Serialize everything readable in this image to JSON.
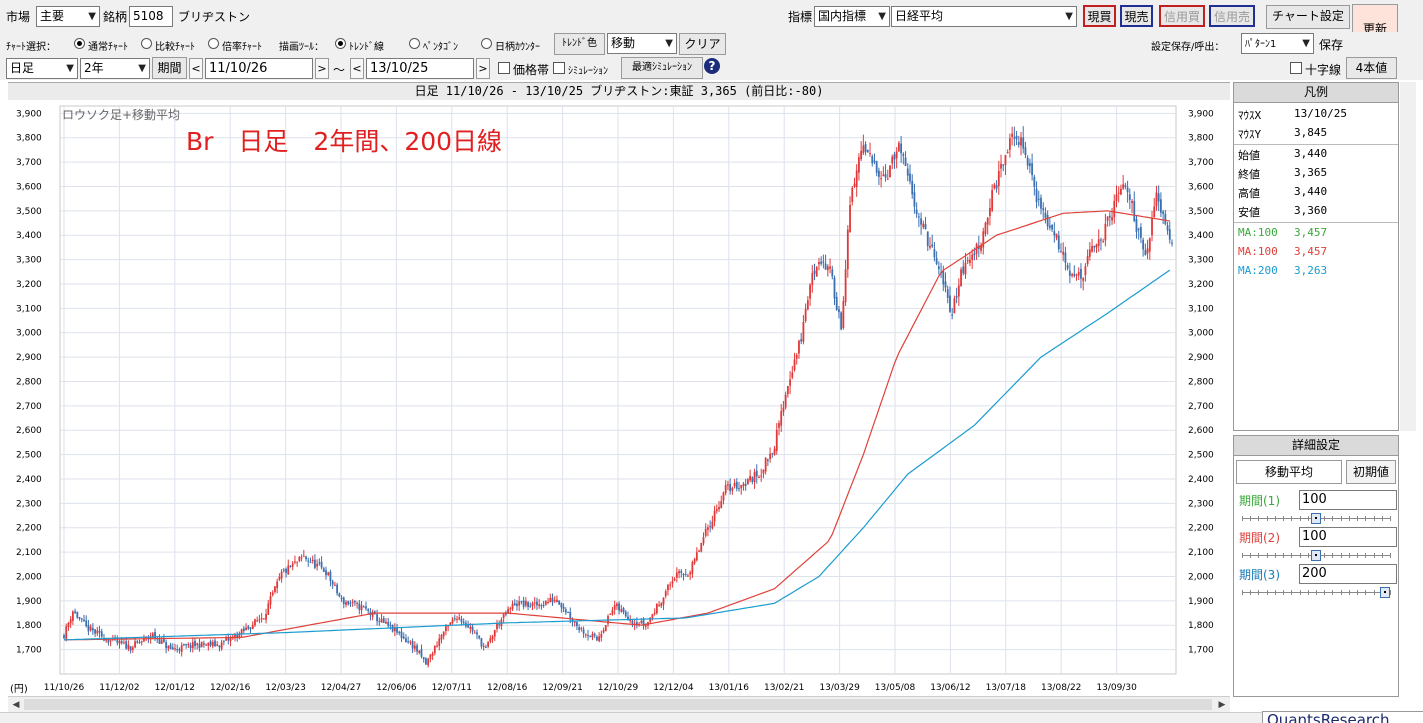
{
  "toolbar1": {
    "market_label": "市場",
    "market_value": "主要",
    "code_label": "銘柄",
    "code_value": "5108",
    "stock_name": "ブリヂストン",
    "indicator_label": "指標",
    "indicator_category": "国内指標",
    "indicator_value": "日経平均",
    "btn_cash_buy": "現買",
    "btn_cash_sell": "現売",
    "btn_margin_buy": "信用買",
    "btn_margin_sell": "信用売",
    "btn_chart_settings": "チャート設定",
    "btn_refresh": "更新"
  },
  "toolbar2": {
    "chart_select_label": "ﾁｬｰﾄ選択：",
    "radio_normal": "通常ﾁｬｰﾄ",
    "radio_compare": "比較ﾁｬｰﾄ",
    "radio_ratio": "倍率ﾁｬｰﾄ",
    "draw_tool_label": "描画ﾂｰﾙ：",
    "radio_trendline": "ﾄﾚﾝﾄﾞ線",
    "radio_pentagon": "ﾍﾟﾝﾀｺﾞﾝ",
    "radio_day_counter": "日柄ｶｳﾝﾀｰ",
    "btn_trend_color": "ﾄﾚﾝﾄﾞ色",
    "move_select": "移動",
    "btn_clear": "クリア",
    "save_load_label": "設定保存/呼出：",
    "pattern_select": "ﾊﾟﾀｰﾝ1",
    "btn_save": "保存"
  },
  "toolbar3": {
    "timeframe": "日足",
    "range": "2年",
    "btn_period": "期間",
    "date_from": "11/10/26",
    "date_to": "13/10/25",
    "tilde": "～",
    "chk_price_band": "価格帯",
    "chk_simulation": "ｼﾐｭﾚｰｼｮﾝ",
    "btn_optimal_sim": "最適ｼﾐｭﾚｰｼｮﾝ",
    "help_glyph": "?",
    "chk_crosshair": "十字線",
    "btn_four_panels": "4本値"
  },
  "chart_header": "日足 11/10/26 - 13/10/25   ブリヂストン:東証  3,365 (前日比:-80)",
  "chart_subtitle": "ロウソク足+移動平均",
  "annotation": "Br　日足　2年間、200日線",
  "yen_unit": "(円)",
  "legend": {
    "title": "凡例",
    "mouse_x_label": "ﾏｳｽX",
    "mouse_x": "13/10/25",
    "mouse_y_label": "ﾏｳｽY",
    "mouse_y": "3,845",
    "open_label": "始値",
    "open": "3,440",
    "close_label": "終値",
    "close": "3,365",
    "high_label": "高値",
    "high": "3,440",
    "low_label": "安値",
    "low": "3,360",
    "ma1_label": "MA:100",
    "ma1": "3,457",
    "ma2_label": "MA:100",
    "ma2": "3,457",
    "ma3_label": "MA:200",
    "ma3": "3,263"
  },
  "detail": {
    "title": "詳細設定",
    "tab_ma": "移動平均",
    "btn_init": "初期値",
    "p1_label": "期間(1)",
    "p1": "100",
    "p2_label": "期間(2)",
    "p2": "100",
    "p3_label": "期間(3)",
    "p3": "200",
    "slider_levels": [
      0.5,
      0.5,
      1.0
    ]
  },
  "brand": "QuantsResearch",
  "colors": {
    "up": "#e03838",
    "down": "#3a6fb0",
    "ma100": "#e0413a",
    "ma200": "#1a9bd0",
    "ma1_text": "#3aa83a",
    "ma2_text": "#e0413a",
    "ma3_text": "#1a9bd0",
    "annotation": "#e02020"
  },
  "chart_data": {
    "type": "candlestick",
    "title": "ロウソク足+移動平均",
    "y_ticks": [
      1700,
      1800,
      1900,
      2000,
      2100,
      2200,
      2300,
      2400,
      2500,
      2600,
      2700,
      2800,
      2900,
      3000,
      3100,
      3200,
      3300,
      3400,
      3500,
      3600,
      3700,
      3800,
      3900
    ],
    "y_tick_labels": [
      "1,700",
      "1,800",
      "1,900",
      "2,000",
      "2,100",
      "2,200",
      "2,300",
      "2,400",
      "2,500",
      "2,600",
      "2,700",
      "2,800",
      "2,900",
      "3,000",
      "3,100",
      "3,200",
      "3,300",
      "3,400",
      "3,500",
      "3,600",
      "3,700",
      "3,800",
      "3,900"
    ],
    "ylim": [
      1600,
      3930
    ],
    "x_labels": [
      "11/10/26",
      "11/12/02",
      "12/01/12",
      "12/02/16",
      "12/03/23",
      "12/04/27",
      "12/06/06",
      "12/07/11",
      "12/08/16",
      "12/09/21",
      "12/10/29",
      "12/12/04",
      "13/01/16",
      "13/02/21",
      "13/03/29",
      "13/05/08",
      "13/06/12",
      "13/07/18",
      "13/08/22",
      "13/09/30"
    ],
    "close_anchors": [
      [
        0,
        1760
      ],
      [
        4,
        1860
      ],
      [
        10,
        1790
      ],
      [
        20,
        1740
      ],
      [
        30,
        1710
      ],
      [
        40,
        1760
      ],
      [
        48,
        1700
      ],
      [
        60,
        1720
      ],
      [
        70,
        1720
      ],
      [
        80,
        1770
      ],
      [
        90,
        1840
      ],
      [
        98,
        2010
      ],
      [
        108,
        2080
      ],
      [
        118,
        2020
      ],
      [
        125,
        1900
      ],
      [
        135,
        1870
      ],
      [
        142,
        1820
      ],
      [
        150,
        1770
      ],
      [
        158,
        1710
      ],
      [
        163,
        1640
      ],
      [
        170,
        1760
      ],
      [
        177,
        1840
      ],
      [
        184,
        1780
      ],
      [
        190,
        1700
      ],
      [
        195,
        1800
      ],
      [
        203,
        1890
      ],
      [
        212,
        1880
      ],
      [
        222,
        1910
      ],
      [
        232,
        1790
      ],
      [
        240,
        1740
      ],
      [
        248,
        1880
      ],
      [
        256,
        1820
      ],
      [
        262,
        1800
      ],
      [
        268,
        1890
      ],
      [
        275,
        2000
      ],
      [
        282,
        2020
      ],
      [
        290,
        2200
      ],
      [
        298,
        2360
      ],
      [
        306,
        2380
      ],
      [
        314,
        2430
      ],
      [
        320,
        2540
      ],
      [
        326,
        2790
      ],
      [
        332,
        2980
      ],
      [
        336,
        3200
      ],
      [
        340,
        3310
      ],
      [
        345,
        3250
      ],
      [
        350,
        3030
      ],
      [
        354,
        3520
      ],
      [
        359,
        3760
      ],
      [
        364,
        3700
      ],
      [
        370,
        3640
      ],
      [
        376,
        3760
      ],
      [
        381,
        3600
      ],
      [
        386,
        3450
      ],
      [
        391,
        3330
      ],
      [
        396,
        3200
      ],
      [
        400,
        3080
      ],
      [
        404,
        3250
      ],
      [
        408,
        3300
      ],
      [
        413,
        3380
      ],
      [
        418,
        3560
      ],
      [
        423,
        3700
      ],
      [
        428,
        3820
      ],
      [
        433,
        3740
      ],
      [
        438,
        3560
      ],
      [
        443,
        3450
      ],
      [
        448,
        3370
      ],
      [
        453,
        3260
      ],
      [
        458,
        3220
      ],
      [
        463,
        3340
      ],
      [
        468,
        3400
      ],
      [
        473,
        3520
      ],
      [
        478,
        3620
      ],
      [
        483,
        3440
      ],
      [
        488,
        3320
      ],
      [
        492,
        3580
      ],
      [
        496,
        3460
      ],
      [
        499,
        3380
      ]
    ],
    "ma_series": [
      {
        "name": "MA:100",
        "anchors": [
          [
            0,
            1740
          ],
          [
            80,
            1750
          ],
          [
            140,
            1850
          ],
          [
            200,
            1850
          ],
          [
            260,
            1800
          ],
          [
            290,
            1850
          ],
          [
            320,
            1950
          ],
          [
            345,
            2150
          ],
          [
            360,
            2500
          ],
          [
            375,
            2900
          ],
          [
            395,
            3250
          ],
          [
            420,
            3400
          ],
          [
            450,
            3490
          ],
          [
            470,
            3500
          ],
          [
            490,
            3470
          ],
          [
            499,
            3457
          ]
        ]
      },
      {
        "name": "MA:200",
        "anchors": [
          [
            0,
            1740
          ],
          [
            100,
            1770
          ],
          [
            200,
            1810
          ],
          [
            280,
            1830
          ],
          [
            320,
            1890
          ],
          [
            340,
            2000
          ],
          [
            360,
            2200
          ],
          [
            380,
            2420
          ],
          [
            410,
            2620
          ],
          [
            440,
            2900
          ],
          [
            470,
            3080
          ],
          [
            499,
            3263
          ]
        ]
      }
    ]
  }
}
